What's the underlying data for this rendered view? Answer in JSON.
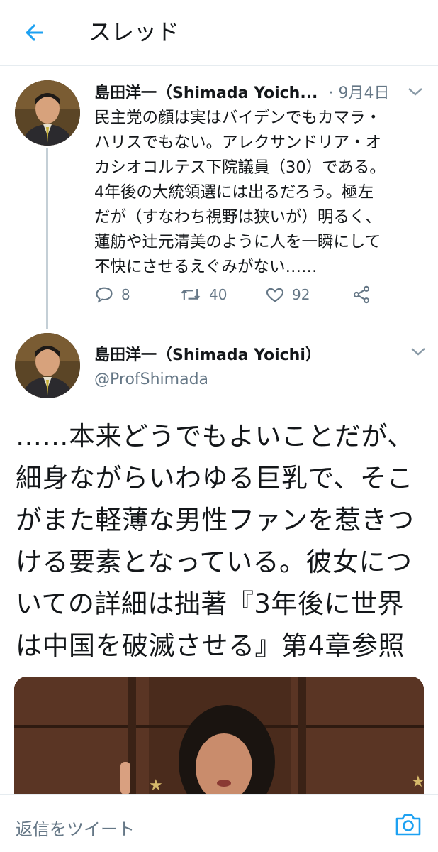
{
  "header": {
    "title": "スレッド",
    "back_icon": "back-arrow-icon"
  },
  "tweet1": {
    "display_name": "島田洋一（Shimada Yoich...",
    "date": "· 9月4日",
    "body": "民主党の顔は実はバイデンでもカマラ・\nハリスでもない。アレクサンドリア・オ\nカシオコルテス下院議員（30）である。\n4年後の大統領選には出るだろう。極左\nだが（すなわち視野は狭いが）明るく、\n蓮舫や辻元清美のように人を一瞬にして\n不快にさせるえぐみがない……",
    "replies": "8",
    "retweets": "40",
    "likes": "92"
  },
  "tweet2": {
    "display_name": "島田洋一（Shimada Yoichi）",
    "handle": "@ProfShimada",
    "body": "……本来どうでもよいことだが、\n細身ながらいわゆる巨乳で、そこ\nがまた軽薄な男性ファンを惹きつ\nける要素となっている。彼女につ\nいての詳細は拙著『3年後に世界\nは中国を破滅させる』第4章参照"
  },
  "reply_bar": {
    "placeholder": "返信をツイート",
    "icon": "camera-icon"
  },
  "colors": {
    "accent": "#1da1f2",
    "muted": "#657786",
    "text": "#14171a",
    "divider": "#e6ecf0"
  }
}
